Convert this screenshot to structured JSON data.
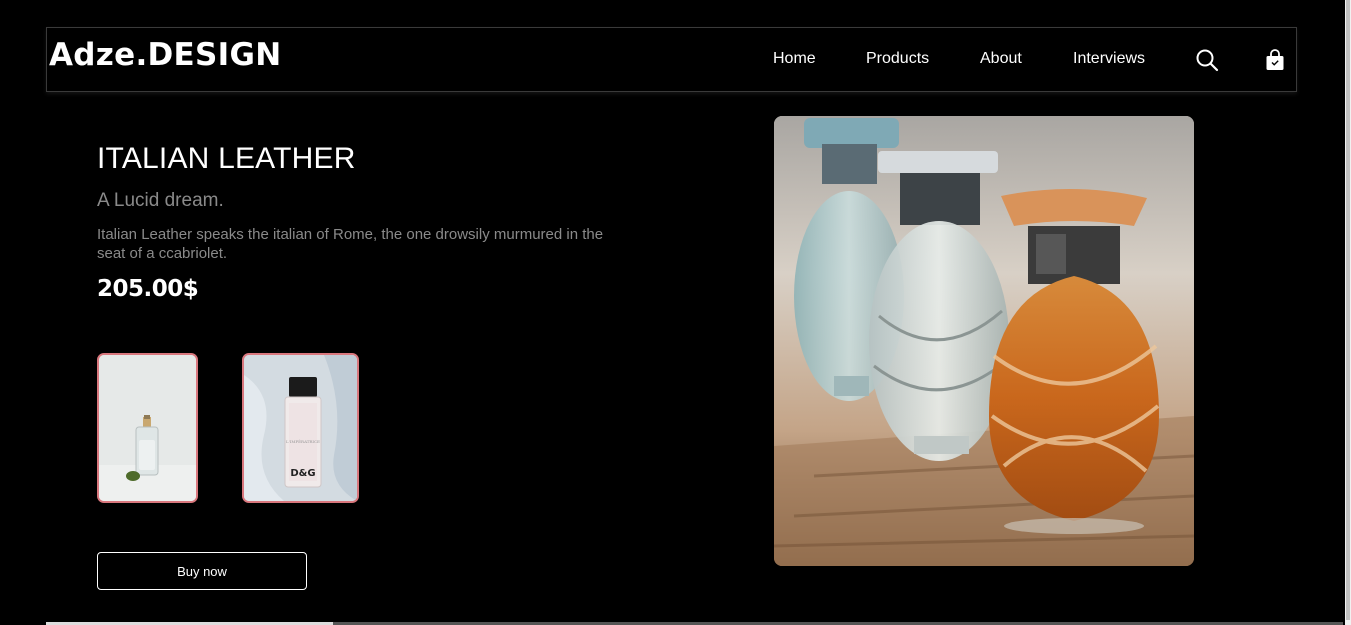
{
  "brand": {
    "logo": "Adze.DESIGN"
  },
  "nav": {
    "links": [
      "Home",
      "Products",
      "About",
      "Interviews"
    ],
    "search_icon": "search-icon",
    "cart_icon": "shopping-bag-icon"
  },
  "product": {
    "title": "ITALIAN LEATHER",
    "tagline": "A Lucid dream.",
    "description": "Italian Leather speaks the italian of Rome, the one drowsily murmured in the seat of a ccabriolet.",
    "price": "205.00$",
    "buy_label": "Buy now",
    "thumbnails": [
      {
        "name": "perfume-thumbnail-1",
        "label": ""
      },
      {
        "name": "perfume-thumbnail-2",
        "label": "D&G"
      }
    ]
  },
  "colors": {
    "background": "#000000",
    "text": "#ffffff",
    "muted": "#8a8a8a",
    "thumb_border": "#d9777d"
  }
}
